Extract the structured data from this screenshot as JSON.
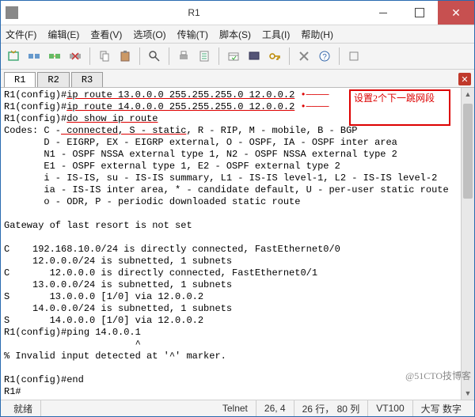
{
  "window": {
    "title": "R1"
  },
  "menus": {
    "file": "文件(F)",
    "edit": "编辑(E)",
    "view": "查看(V)",
    "options": "选项(O)",
    "transfer": "传输(T)",
    "script": "脚本(S)",
    "tools": "工具(I)",
    "help": "帮助(H)"
  },
  "tabs": {
    "t1": "R1",
    "t2": "R2",
    "t3": "R3"
  },
  "callout": "设置2个下一跳网段",
  "term": {
    "l01a": "R1(config)#",
    "l01b": "ip route 13.0.0.0 255.255.255.0 12.0.0.2",
    "l01c": " •────",
    "l02a": "R1(config)#",
    "l02b": "ip route 14.0.0.0 255.255.255.0 12.0.0.2",
    "l02c": " •────",
    "l03a": "R1(config)#",
    "l03b": "do show ip route",
    "l04a": "Codes: C -",
    "l04b": " connected, S - static",
    "l04c": ", R - RIP, M - mobile, B - BGP",
    "l05": "       D - EIGRP, EX - EIGRP external, O - OSPF, IA - OSPF inter area",
    "l06": "       N1 - OSPF NSSA external type 1, N2 - OSPF NSSA external type 2",
    "l07": "       E1 - OSPF external type 1, E2 - OSPF external type 2",
    "l08": "       i - IS-IS, su - IS-IS summary, L1 - IS-IS level-1, L2 - IS-IS level-2",
    "l09": "       ia - IS-IS inter area, * - candidate default, U - per-user static route",
    "l10": "       o - ODR, P - periodic downloaded static route",
    "l11": "",
    "l12": "Gateway of last resort is not set",
    "l13": "",
    "l14": "C    192.168.10.0/24 is directly connected, FastEthernet0/0",
    "l15": "     12.0.0.0/24 is subnetted, 1 subnets",
    "l16": "C       12.0.0.0 is directly connected, FastEthernet0/1",
    "l17": "     13.0.0.0/24 is subnetted, 1 subnets",
    "l18": "S       13.0.0.0 [1/0] via 12.0.0.2",
    "l19": "     14.0.0.0/24 is subnetted, 1 subnets",
    "l20": "S       14.0.0.0 [1/0] via 12.0.0.2",
    "l21": "R1(config)#ping 14.0.0.1",
    "l22": "                       ^",
    "l23": "% Invalid input detected at '^' marker.",
    "l24": "",
    "l25": "R1(config)#end",
    "l26": "R1#"
  },
  "status": {
    "ready": "就绪",
    "conn": "Telnet",
    "pos": "26, 4",
    "size": "26 行， 80 列",
    "term": "VT100",
    "caps": "大写 数字"
  },
  "watermark": "@51CTO技博客"
}
